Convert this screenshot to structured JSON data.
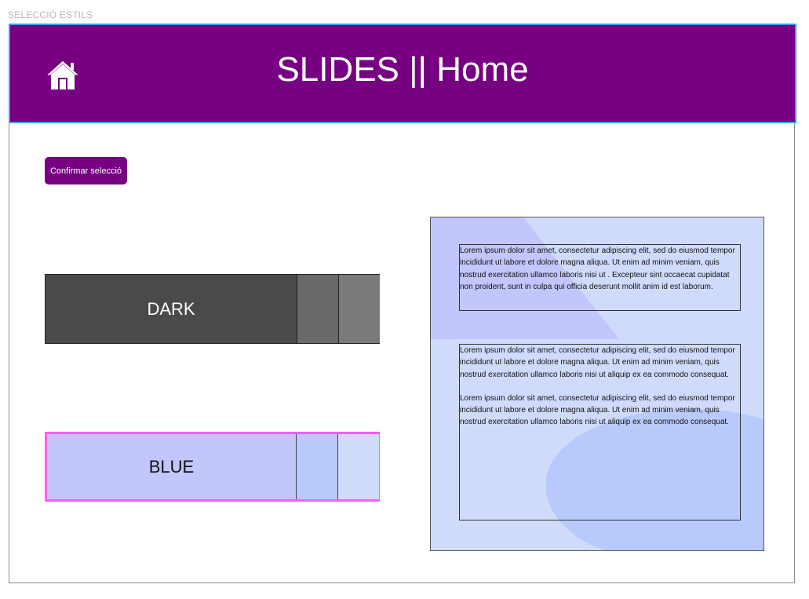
{
  "frame_label": "SELECCIÓ ESTILS",
  "header": {
    "title": "SLIDES || Home",
    "home_icon": "home-icon",
    "bg_color": "#770082"
  },
  "confirm_button": {
    "label": "Confirmar selecció"
  },
  "themes": [
    {
      "label": "DARK",
      "colors": [
        "#4a4a4a",
        "#696969",
        "#7a7a7a"
      ],
      "selected": false
    },
    {
      "label": "BLUE",
      "colors": [
        "#c2c6fc",
        "#b8cafc",
        "#d1dcfd"
      ],
      "selected": true
    }
  ],
  "preview": {
    "box1": "Lorem ipsum dolor sit amet, consectetur adipiscing elit, sed do eiusmod tempor incididunt ut labore et dolore magna aliqua. Ut enim ad minim veniam, quis nostrud exercitation ullamco laboris nisi ut . Excepteur sint occaecat cupidatat non proident, sunt in culpa qui officia deserunt mollit anim id est laborum.",
    "box2_p1": "Lorem ipsum dolor sit amet, consectetur adipiscing elit, sed do eiusmod tempor incididunt ut labore et dolore magna aliqua. Ut enim ad minim veniam, quis nostrud exercitation ullamco laboris nisi ut aliquip ex ea commodo consequat.",
    "box2_p2": "Lorem ipsum dolor sit amet, consectetur adipiscing elit, sed do eiusmod tempor incididunt ut labore et dolore magna aliqua. Ut enim ad minim veniam, quis nostrud exercitation ullamco laboris nisi ut aliquip ex ea commodo consequat."
  }
}
